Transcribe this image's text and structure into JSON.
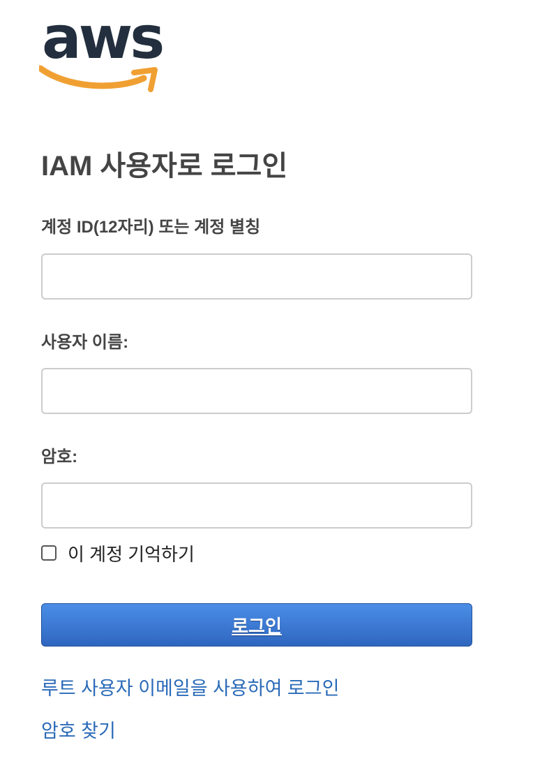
{
  "logo": {
    "text": "aws",
    "text_color": "#232f3e",
    "smile_color": "#f0a032"
  },
  "header": {
    "title": "IAM 사용자로 로그인"
  },
  "form": {
    "account_label": "계정 ID(12자리) 또는 계정 별칭",
    "account_value": "",
    "username_label": "사용자 이름:",
    "username_value": "",
    "password_label": "암호:",
    "password_value": "",
    "remember_label": "이 계정 기억하기",
    "remember_checked": false,
    "signin_label": "로그인"
  },
  "links": {
    "root_signin": "루트 사용자 이메일을 사용하여 로그인",
    "forgot_password": "암호 찾기"
  },
  "colors": {
    "button_blue": "#3d7ad4",
    "link_blue": "#2a6ab8",
    "input_border": "#cccccc"
  }
}
